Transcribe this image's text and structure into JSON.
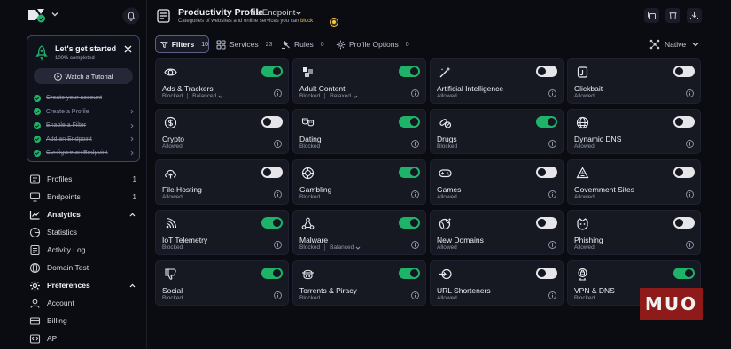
{
  "sidebar": {
    "getting_started": {
      "title": "Let's get started",
      "progress": "100% completed",
      "tutorial_label": "Watch a Tutorial",
      "steps": [
        {
          "label": "Create your account",
          "done": true
        },
        {
          "label": "Create a Profile",
          "done": true
        },
        {
          "label": "Enable a Filter",
          "done": true
        },
        {
          "label": "Add an Endpoint",
          "done": true
        },
        {
          "label": "Configure an Endpoint",
          "done": true
        }
      ]
    },
    "nav": {
      "profiles": {
        "label": "Profiles",
        "count": "1"
      },
      "endpoints": {
        "label": "Endpoints",
        "count": "1"
      },
      "analytics": {
        "label": "Analytics"
      },
      "statistics": {
        "label": "Statistics"
      },
      "activity_log": {
        "label": "Activity Log"
      },
      "domain_test": {
        "label": "Domain Test"
      },
      "preferences": {
        "label": "Preferences"
      },
      "account": {
        "label": "Account"
      },
      "billing": {
        "label": "Billing"
      },
      "api": {
        "label": "API"
      }
    }
  },
  "header": {
    "title": "Productivity Profile",
    "endpoint": "1 Endpoint",
    "description_prefix": "Categories of websites and online services you can",
    "description_highlight": "block"
  },
  "tabs": {
    "filters": {
      "label": "Filters",
      "count": "10"
    },
    "services": {
      "label": "Services",
      "count": "23"
    },
    "rules": {
      "label": "Rules",
      "count": "0"
    },
    "profile_options": {
      "label": "Profile Options",
      "count": "0"
    },
    "mode": "Native"
  },
  "colors": {
    "toggle_on": "#1fb36a",
    "toggle_off": "#e6e6ea",
    "highlight": "#f4c64a",
    "accent_border": "#3c4468",
    "watermark": "#8f1a1a"
  },
  "categories": [
    {
      "name": "Ads & Trackers",
      "status": "Blocked",
      "mode": "Balanced",
      "on": true,
      "icon": "eye-icon"
    },
    {
      "name": "Adult Content",
      "status": "Blocked",
      "mode": "Relaxed",
      "on": true,
      "icon": "squares-icon"
    },
    {
      "name": "Artificial Intelligence",
      "status": "Allowed",
      "on": false,
      "icon": "magic-wand-icon"
    },
    {
      "name": "Clickbait",
      "status": "Allowed",
      "on": false,
      "icon": "bait-icon"
    },
    {
      "name": "Crypto",
      "status": "Allowed",
      "on": false,
      "icon": "coin-icon"
    },
    {
      "name": "Dating",
      "status": "Blocked",
      "on": true,
      "icon": "masks-icon"
    },
    {
      "name": "Drugs",
      "status": "Blocked",
      "on": true,
      "icon": "pills-icon"
    },
    {
      "name": "Dynamic DNS",
      "status": "Allowed",
      "on": false,
      "icon": "globe-icon"
    },
    {
      "name": "File Hosting",
      "status": "Allowed",
      "on": false,
      "icon": "cloud-upload-icon"
    },
    {
      "name": "Gambling",
      "status": "Blocked",
      "on": true,
      "icon": "chip-icon"
    },
    {
      "name": "Games",
      "status": "Allowed",
      "on": false,
      "icon": "gamepad-icon"
    },
    {
      "name": "Government Sites",
      "status": "Allowed",
      "on": false,
      "icon": "government-icon"
    },
    {
      "name": "IoT Telemetry",
      "status": "Blocked",
      "on": true,
      "icon": "signal-icon"
    },
    {
      "name": "Malware",
      "status": "Blocked",
      "mode": "Balanced",
      "on": true,
      "icon": "network-icon"
    },
    {
      "name": "New Domains",
      "status": "Allowed",
      "on": false,
      "icon": "sparkle-globe-icon"
    },
    {
      "name": "Phishing",
      "status": "Allowed",
      "on": false,
      "icon": "fishhook-icon"
    },
    {
      "name": "Social",
      "status": "Blocked",
      "on": true,
      "icon": "thumbs-down-icon"
    },
    {
      "name": "Torrents & Piracy",
      "status": "Blocked",
      "on": true,
      "icon": "pirate-icon"
    },
    {
      "name": "URL Shorteners",
      "status": "Allowed",
      "on": false,
      "icon": "shortener-icon"
    },
    {
      "name": "VPN & DNS",
      "status": "Blocked",
      "on": true,
      "icon": "vpn-icon"
    }
  ],
  "watermark": "MUO"
}
